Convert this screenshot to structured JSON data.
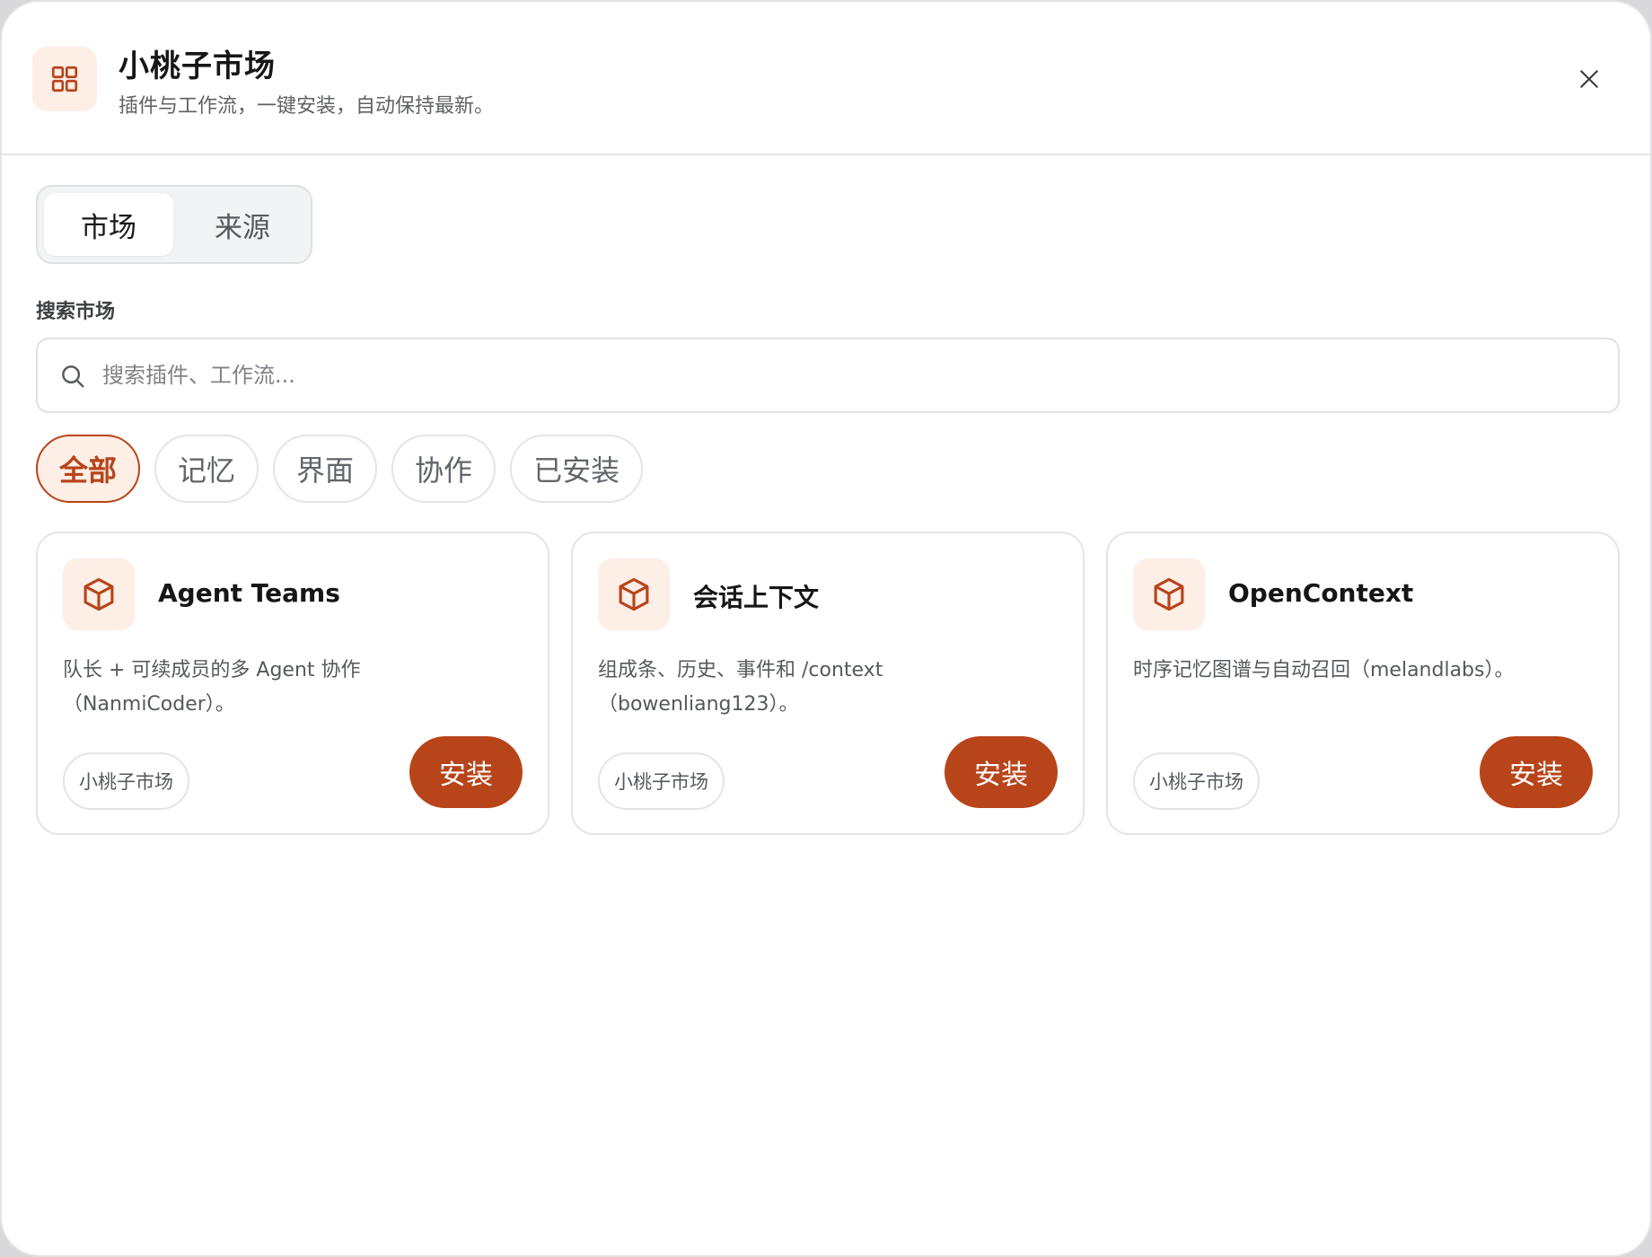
{
  "header": {
    "title": "小桃子市场",
    "subtitle": "插件与工作流，一键安装，自动保持最新。",
    "app_icon": "grid-icon",
    "close_icon": "close-icon"
  },
  "tabs": [
    {
      "label": "市场",
      "active": true
    },
    {
      "label": "来源",
      "active": false
    }
  ],
  "search": {
    "label": "搜索市场",
    "placeholder": "搜索插件、工作流...",
    "value": ""
  },
  "filters": [
    {
      "label": "全部",
      "active": true
    },
    {
      "label": "记忆",
      "active": false
    },
    {
      "label": "界面",
      "active": false
    },
    {
      "label": "协作",
      "active": false
    },
    {
      "label": "已安装",
      "active": false
    }
  ],
  "cards": [
    {
      "icon": "package-icon",
      "title": "Agent Teams",
      "description": "队长 + 可续成员的多 Agent 协作（NanmiCoder）。",
      "source": "小桃子市场",
      "action": "安装"
    },
    {
      "icon": "package-icon",
      "title": "会话上下文",
      "description": "组成条、历史、事件和 /context（bowenliang123）。",
      "source": "小桃子市场",
      "action": "安装"
    },
    {
      "icon": "package-icon",
      "title": "OpenContext",
      "description": "时序记忆图谱与自动召回（melandlabs）。",
      "source": "小桃子市场",
      "action": "安装"
    }
  ],
  "colors": {
    "accent": "#b8441a",
    "accent_soft": "#fdeee6",
    "border": "#e3e4e7",
    "text_primary": "#161616",
    "text_secondary": "#55585e"
  }
}
